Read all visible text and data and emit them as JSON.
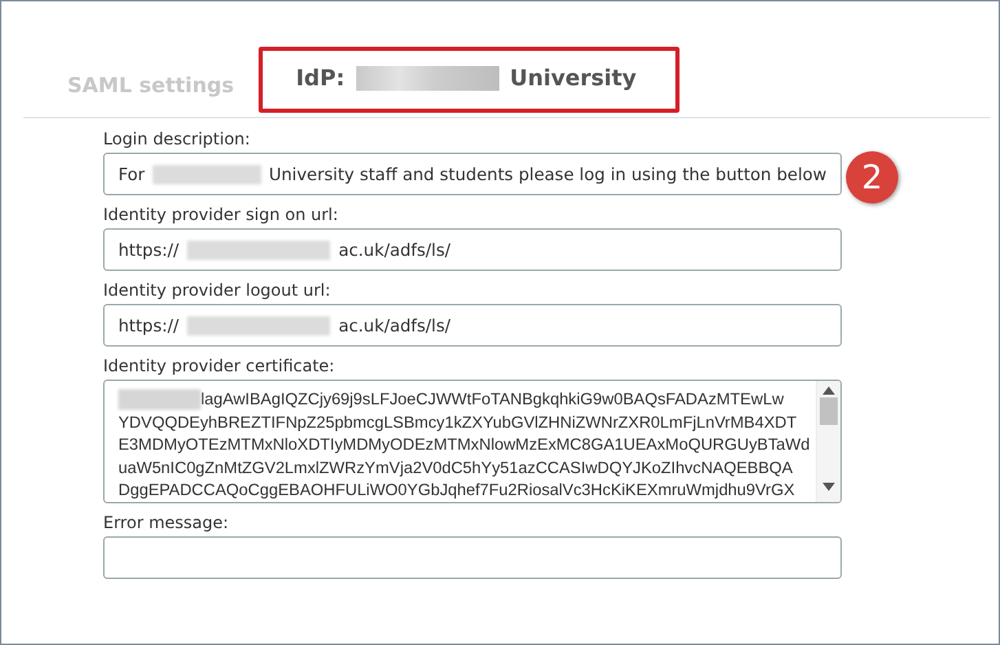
{
  "tabs": [
    {
      "label_prefix": "SAML settings",
      "selected": false
    },
    {
      "label_prefix": "IdP:",
      "label_suffix": "University",
      "selected": true
    }
  ],
  "callout": {
    "number": "2"
  },
  "fields": [
    {
      "label": "Login description:",
      "kind": "input",
      "value_prefix": "For",
      "value_suffix": "University staff and students please log in using the button below"
    },
    {
      "label": "Identity provider sign on url:",
      "kind": "input",
      "value_prefix": "https://",
      "value_suffix": "ac.uk/adfs/ls/"
    },
    {
      "label": "Identity provider logout url:",
      "kind": "input",
      "value_prefix": "https://",
      "value_suffix": "ac.uk/adfs/ls/"
    },
    {
      "label": "Identity provider certificate:",
      "kind": "textarea",
      "lines": [
        "lagAwIBAgIQZCjy69j9sLFJoeCJWWtFoTANBgkqhkiG9w0BAQsFADAzMTEwLw",
        "YDVQQDEyhBREZTIFNpZ25pbmcgLSBmcy1kZXYubGVlZHNiZWNrZXR0LmFjLnVrMB4XDT",
        "E3MDMyOTEzMTMxNloXDTIyMDMyODEzMTMxNlowMzExMC8GA1UEAxMoQURGUyBTaWd",
        "uaW5nIC0gZnMtZGV2LmxlZWRzYmVja2V0dC5hYy51azCCASIwDQYJKoZIhvcNAQEBBQA",
        "DggEPADCCAQoCggEBAOHFULiWO0YGbJqhef7Fu2RiosalVc3HcKiKEXmruWmjdhu9VrGX"
      ]
    },
    {
      "label": "Error message:",
      "kind": "input"
    }
  ]
}
